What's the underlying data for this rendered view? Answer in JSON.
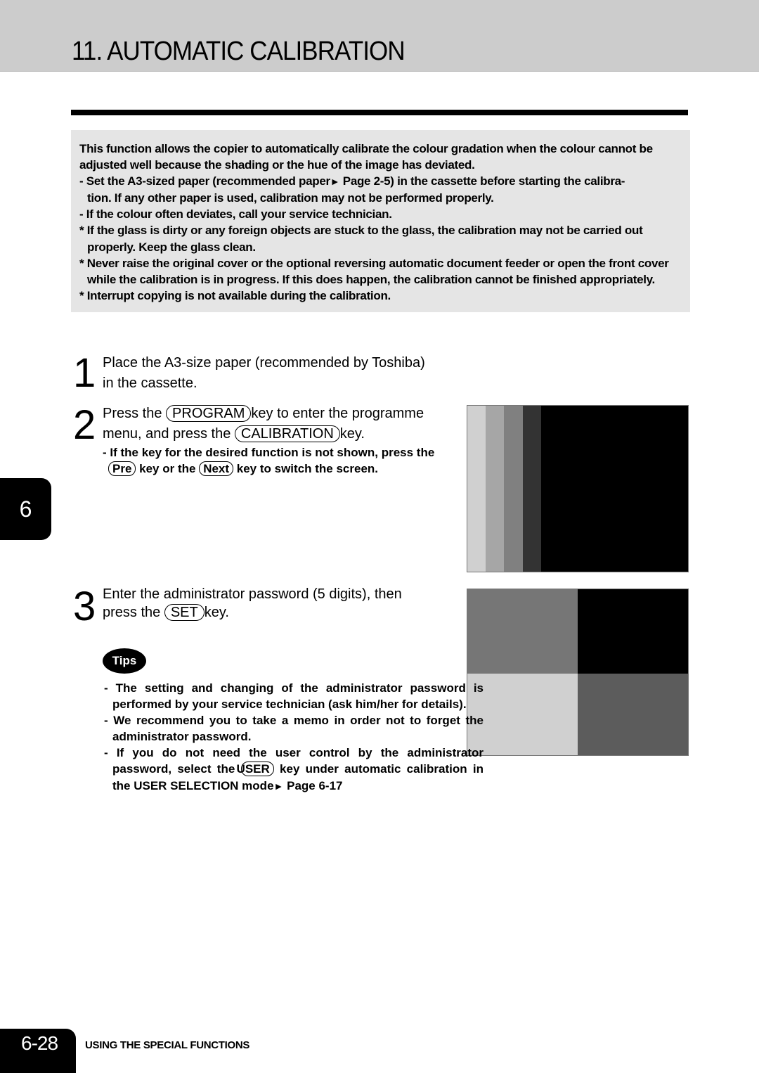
{
  "header": {
    "title": "11. AUTOMATIC CALIBRATION"
  },
  "info_box": {
    "intro_line1": "This function allows the copier to automatically calibrate the colour gradation when the colour cannot be",
    "intro_line2": "adjusted well because the shading or the hue of the image has deviated.",
    "note1_a": "- Set the A3-sized paper (recommended paper",
    "note1_arrow": "►",
    "note1_b": " Page 2-5) in the cassette before starting the calibra-",
    "note1_c": "tion.  If any other paper is used, calibration may not be performed properly.",
    "note2": "- If the colour often deviates, call your service technician.",
    "note3_a": "* If the glass is dirty or any foreign objects are stuck to the glass, the calibration may not be carried out",
    "note3_b": "properly.  Keep the glass clean.",
    "note4_a": "* Never raise the original cover or the optional  reversing automatic document feeder or open the front cover",
    "note4_b": "while the calibration is in progress.  If this does happen, the calibration cannot be finished appropriately.",
    "note5": "* Interrupt copying is not available during the calibration."
  },
  "steps": [
    {
      "number": "1",
      "line1": "Place the A3-size paper (recommended by Toshiba)",
      "line2": "in the cassette."
    },
    {
      "number": "2",
      "pre1": "Press the ",
      "key1": "PROGRAM",
      "post1": "key to enter the programme",
      "pre2": "menu,  and press the ",
      "key2": "CALIBRATION",
      "post2": "key.",
      "sub_line1": "- If the key for the desired function is not shown, press the",
      "sub_key1": "Pre",
      "sub_mid": " key or the ",
      "sub_key2": "Next",
      "sub_post": "  key to switch the screen."
    },
    {
      "number": "3",
      "line1": "Enter  the  administrator  password  (5  digits),  then",
      "pre2": "press the ",
      "key1": "SET",
      "post2": "key."
    }
  ],
  "screens": {
    "calibration_bars": [
      "#d0d0d0",
      "#a6a6a6",
      "#808080",
      "#333333",
      "#000000"
    ],
    "calibration_quadrants": [
      "#767676",
      "#000000",
      "#d0d0d0",
      "#5c5c5c"
    ]
  },
  "tips": {
    "badge": "Tips",
    "item1": "- The setting and changing of the administrator password is performed by your service technician (ask him/her for details).",
    "item2": "- We recommend you to take a memo in order not to forget the administrator password.",
    "item3_a": "- If you do not need the user control by the administrator password, select the ",
    "item3_key": "USER",
    "item3_b": " key under automatic calibration in the USER SELECTION mode",
    "item3_arrow": "►",
    "item3_c": " Page 6-17"
  },
  "chapter_tab": "6",
  "footer": {
    "page_number": "6-28",
    "section": "USING THE SPECIAL FUNCTIONS"
  }
}
